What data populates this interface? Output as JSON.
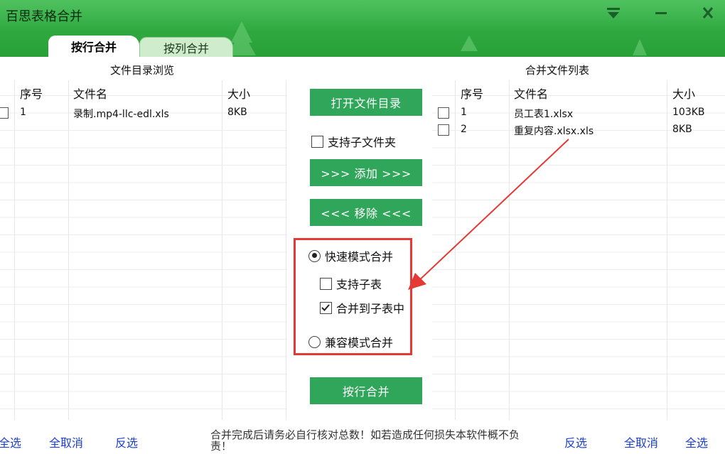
{
  "window": {
    "title": "百思表格合并",
    "menu_icon": "dropdown-icon",
    "minimize_icon": "minimize-icon",
    "close_icon": "close-icon"
  },
  "tabs": [
    {
      "label": "按行合并",
      "active": true
    },
    {
      "label": "按列合并",
      "active": false
    }
  ],
  "left_panel": {
    "caption": "文件目录浏览",
    "columns": [
      "序号",
      "文件名",
      "大小"
    ],
    "rows": [
      {
        "index": "1",
        "name": "录制.mp4-llc-edl.xls",
        "size": "8KB",
        "checked": false
      }
    ]
  },
  "right_panel": {
    "caption": "合并文件列表",
    "columns": [
      "序号",
      "文件名",
      "大小"
    ],
    "rows": [
      {
        "index": "1",
        "name": "员工表1.xlsx",
        "size": "103KB",
        "checked": false
      },
      {
        "index": "2",
        "name": "重复内容.xlsx.xls",
        "size": "8KB",
        "checked": false
      }
    ]
  },
  "center": {
    "open_dir_button": "打开文件目录",
    "include_subfolders": {
      "label": "支持子文件夹",
      "checked": false
    },
    "add_button": ">>> 添加 >>>",
    "remove_button": "<<< 移除 <<<",
    "fast_mode": {
      "label": "快速模式合并",
      "selected": true
    },
    "support_subsheet": {
      "label": "支持子表",
      "checked": false
    },
    "merge_to_subsheet": {
      "label": "合并到子表中",
      "checked": true
    },
    "compat_mode": {
      "label": "兼容模式合并",
      "selected": false
    },
    "merge_rows_button": "按行合并"
  },
  "footer": {
    "left": {
      "select_all": "全选",
      "deselect_all": "全取消",
      "invert": "反选"
    },
    "notice": "合并完成后请务必自行核对总数！如若造成任何损失本软件概不负责！",
    "right": {
      "invert": "反选",
      "deselect_all": "全取消",
      "select_all": "全选"
    }
  },
  "colors": {
    "titlebar_green": "#2fa93f",
    "button_green": "#2fa65a",
    "annotation_red": "#e53935",
    "link_blue": "#1d3fcf"
  }
}
